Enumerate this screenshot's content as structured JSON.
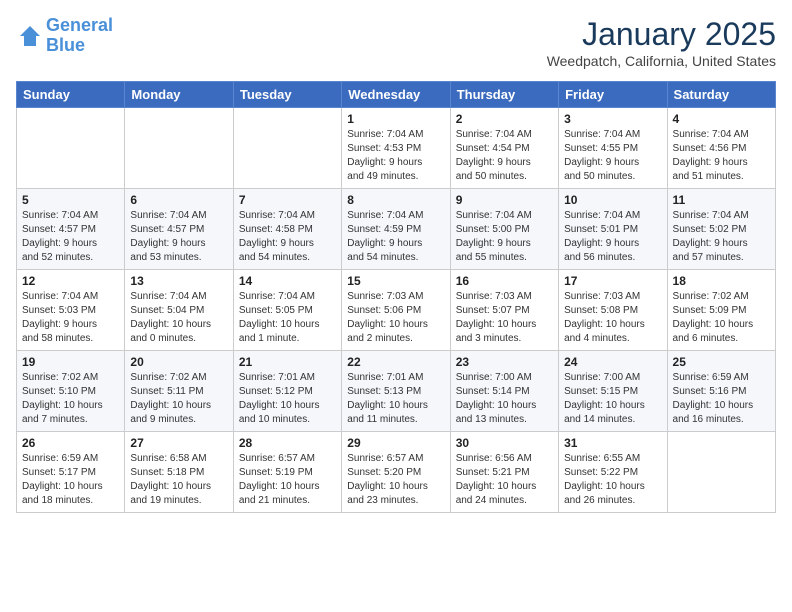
{
  "logo": {
    "line1": "General",
    "line2": "Blue"
  },
  "title": "January 2025",
  "location": "Weedpatch, California, United States",
  "weekdays": [
    "Sunday",
    "Monday",
    "Tuesday",
    "Wednesday",
    "Thursday",
    "Friday",
    "Saturday"
  ],
  "weeks": [
    [
      {
        "day": "",
        "info": ""
      },
      {
        "day": "",
        "info": ""
      },
      {
        "day": "",
        "info": ""
      },
      {
        "day": "1",
        "info": "Sunrise: 7:04 AM\nSunset: 4:53 PM\nDaylight: 9 hours\nand 49 minutes."
      },
      {
        "day": "2",
        "info": "Sunrise: 7:04 AM\nSunset: 4:54 PM\nDaylight: 9 hours\nand 50 minutes."
      },
      {
        "day": "3",
        "info": "Sunrise: 7:04 AM\nSunset: 4:55 PM\nDaylight: 9 hours\nand 50 minutes."
      },
      {
        "day": "4",
        "info": "Sunrise: 7:04 AM\nSunset: 4:56 PM\nDaylight: 9 hours\nand 51 minutes."
      }
    ],
    [
      {
        "day": "5",
        "info": "Sunrise: 7:04 AM\nSunset: 4:57 PM\nDaylight: 9 hours\nand 52 minutes."
      },
      {
        "day": "6",
        "info": "Sunrise: 7:04 AM\nSunset: 4:57 PM\nDaylight: 9 hours\nand 53 minutes."
      },
      {
        "day": "7",
        "info": "Sunrise: 7:04 AM\nSunset: 4:58 PM\nDaylight: 9 hours\nand 54 minutes."
      },
      {
        "day": "8",
        "info": "Sunrise: 7:04 AM\nSunset: 4:59 PM\nDaylight: 9 hours\nand 54 minutes."
      },
      {
        "day": "9",
        "info": "Sunrise: 7:04 AM\nSunset: 5:00 PM\nDaylight: 9 hours\nand 55 minutes."
      },
      {
        "day": "10",
        "info": "Sunrise: 7:04 AM\nSunset: 5:01 PM\nDaylight: 9 hours\nand 56 minutes."
      },
      {
        "day": "11",
        "info": "Sunrise: 7:04 AM\nSunset: 5:02 PM\nDaylight: 9 hours\nand 57 minutes."
      }
    ],
    [
      {
        "day": "12",
        "info": "Sunrise: 7:04 AM\nSunset: 5:03 PM\nDaylight: 9 hours\nand 58 minutes."
      },
      {
        "day": "13",
        "info": "Sunrise: 7:04 AM\nSunset: 5:04 PM\nDaylight: 10 hours\nand 0 minutes."
      },
      {
        "day": "14",
        "info": "Sunrise: 7:04 AM\nSunset: 5:05 PM\nDaylight: 10 hours\nand 1 minute."
      },
      {
        "day": "15",
        "info": "Sunrise: 7:03 AM\nSunset: 5:06 PM\nDaylight: 10 hours\nand 2 minutes."
      },
      {
        "day": "16",
        "info": "Sunrise: 7:03 AM\nSunset: 5:07 PM\nDaylight: 10 hours\nand 3 minutes."
      },
      {
        "day": "17",
        "info": "Sunrise: 7:03 AM\nSunset: 5:08 PM\nDaylight: 10 hours\nand 4 minutes."
      },
      {
        "day": "18",
        "info": "Sunrise: 7:02 AM\nSunset: 5:09 PM\nDaylight: 10 hours\nand 6 minutes."
      }
    ],
    [
      {
        "day": "19",
        "info": "Sunrise: 7:02 AM\nSunset: 5:10 PM\nDaylight: 10 hours\nand 7 minutes."
      },
      {
        "day": "20",
        "info": "Sunrise: 7:02 AM\nSunset: 5:11 PM\nDaylight: 10 hours\nand 9 minutes."
      },
      {
        "day": "21",
        "info": "Sunrise: 7:01 AM\nSunset: 5:12 PM\nDaylight: 10 hours\nand 10 minutes."
      },
      {
        "day": "22",
        "info": "Sunrise: 7:01 AM\nSunset: 5:13 PM\nDaylight: 10 hours\nand 11 minutes."
      },
      {
        "day": "23",
        "info": "Sunrise: 7:00 AM\nSunset: 5:14 PM\nDaylight: 10 hours\nand 13 minutes."
      },
      {
        "day": "24",
        "info": "Sunrise: 7:00 AM\nSunset: 5:15 PM\nDaylight: 10 hours\nand 14 minutes."
      },
      {
        "day": "25",
        "info": "Sunrise: 6:59 AM\nSunset: 5:16 PM\nDaylight: 10 hours\nand 16 minutes."
      }
    ],
    [
      {
        "day": "26",
        "info": "Sunrise: 6:59 AM\nSunset: 5:17 PM\nDaylight: 10 hours\nand 18 minutes."
      },
      {
        "day": "27",
        "info": "Sunrise: 6:58 AM\nSunset: 5:18 PM\nDaylight: 10 hours\nand 19 minutes."
      },
      {
        "day": "28",
        "info": "Sunrise: 6:57 AM\nSunset: 5:19 PM\nDaylight: 10 hours\nand 21 minutes."
      },
      {
        "day": "29",
        "info": "Sunrise: 6:57 AM\nSunset: 5:20 PM\nDaylight: 10 hours\nand 23 minutes."
      },
      {
        "day": "30",
        "info": "Sunrise: 6:56 AM\nSunset: 5:21 PM\nDaylight: 10 hours\nand 24 minutes."
      },
      {
        "day": "31",
        "info": "Sunrise: 6:55 AM\nSunset: 5:22 PM\nDaylight: 10 hours\nand 26 minutes."
      },
      {
        "day": "",
        "info": ""
      }
    ]
  ]
}
